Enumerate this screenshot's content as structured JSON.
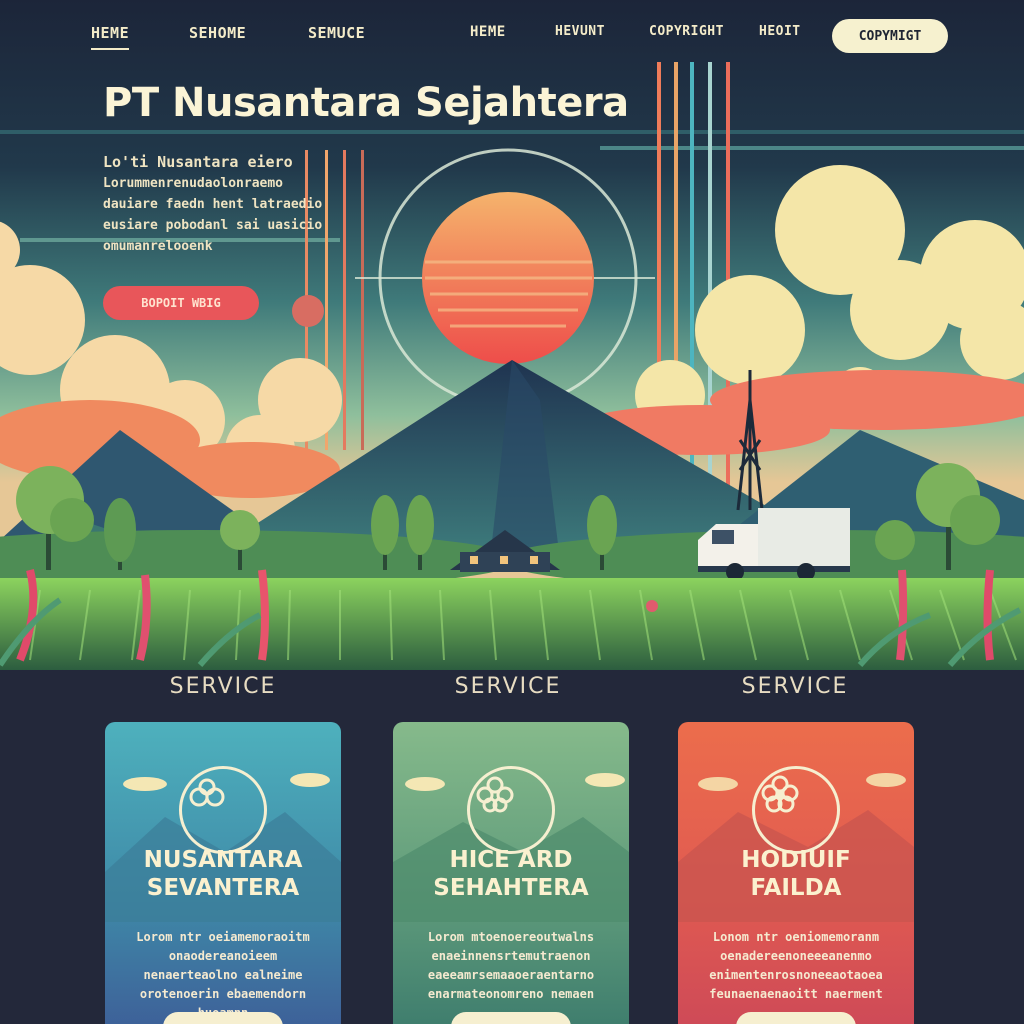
{
  "nav": {
    "items": [
      "HEME",
      "SEHOME",
      "SEMUCE",
      "HEME",
      "HEVUNT",
      "COPYRIGHT",
      "HEOIT"
    ],
    "cta": "COPYMIGT"
  },
  "hero": {
    "title": "PT Nusantara Sejahtera",
    "intro_lead": "Lo'ti Nusantara eiero",
    "intro_lines": [
      "Lorummenrenudaolonraemo",
      "dauiare faedn hent latraedio",
      "eusiare pobodanl sai uasicio",
      "omumanrelooenk"
    ],
    "button": "BOPOIT WBIG"
  },
  "services": [
    {
      "heading": "SERVICE",
      "title": "NUSANTARA\nSEVANTERA",
      "text": "Lorom ntr oeiamemoraoitm onaodereanoieem nenaerteaolno ealneime orotenoerin ebaemendorn huoamnn",
      "icon": "flower-icon",
      "color_top": "#4aa6b4",
      "color_bottom": "#3a5f98"
    },
    {
      "heading": "SERVICE",
      "title": "HICE ARD\nSEHAHTERA",
      "text": "Lorom mtoenoereoutwalns enaeinnensrtemutraenon eaeeamrsemaaoeraentarno enarmateonomreno nemaen",
      "icon": "flower-icon",
      "color_top": "#7fb48a",
      "color_bottom": "#3c7d6f"
    },
    {
      "heading": "SERVICE",
      "title": "HODIUIF\nFAILDA",
      "text": "Lonom ntr oeniomemoranm oenadereenoneeeanenmo enimentenrosnoneeaotaoea feunaenaenaoitt naerment",
      "icon": "flower-icon",
      "color_top": "#e96a4e",
      "color_bottom": "#cf4a57"
    }
  ]
}
